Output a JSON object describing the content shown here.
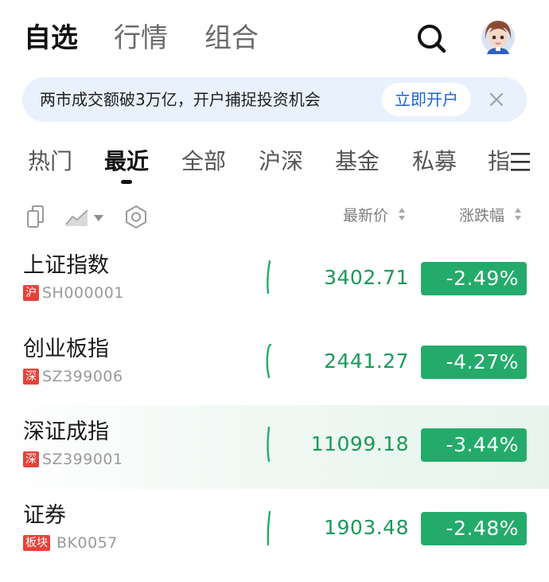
{
  "topnav": {
    "tabs": [
      {
        "label": "自选",
        "active": true
      },
      {
        "label": "行情",
        "active": false
      },
      {
        "label": "组合",
        "active": false
      }
    ],
    "search_icon": "search-icon",
    "avatar_icon": "user-avatar"
  },
  "banner": {
    "text": "两市成交额破3万亿，开户捕捉投资机会",
    "button_label": "立即开户",
    "close_icon": "close-icon"
  },
  "categories": {
    "items": [
      "热门",
      "最近",
      "全部",
      "沪深",
      "基金",
      "私募",
      "指"
    ],
    "active": "最近",
    "menu_icon": "menu-icon"
  },
  "toolbar": {
    "icons": [
      "copy-icon",
      "trend-chart-icon",
      "settings-hex-icon"
    ],
    "col_price": "最新价",
    "col_change": "涨跌幅"
  },
  "stocks": [
    {
      "name": "上证指数",
      "tag": "沪",
      "code": "SH000001",
      "price": "3402.71",
      "change": "-2.49%"
    },
    {
      "name": "创业板指",
      "tag": "深",
      "code": "SZ399006",
      "price": "2441.27",
      "change": "-4.27%"
    },
    {
      "name": "深证成指",
      "tag": "深",
      "code": "SZ399001",
      "price": "11099.18",
      "change": "-3.44%"
    },
    {
      "name": "证券",
      "tag": "板块",
      "code": "BK0057",
      "price": "1903.48",
      "change": "-2.48%"
    }
  ],
  "colors": {
    "down_green": "#24ab6b",
    "price_green": "#1a9a5a",
    "tag_red": "#e8413b",
    "accent_blue": "#1d5fe0",
    "banner_bg": "#e8f1fc"
  }
}
